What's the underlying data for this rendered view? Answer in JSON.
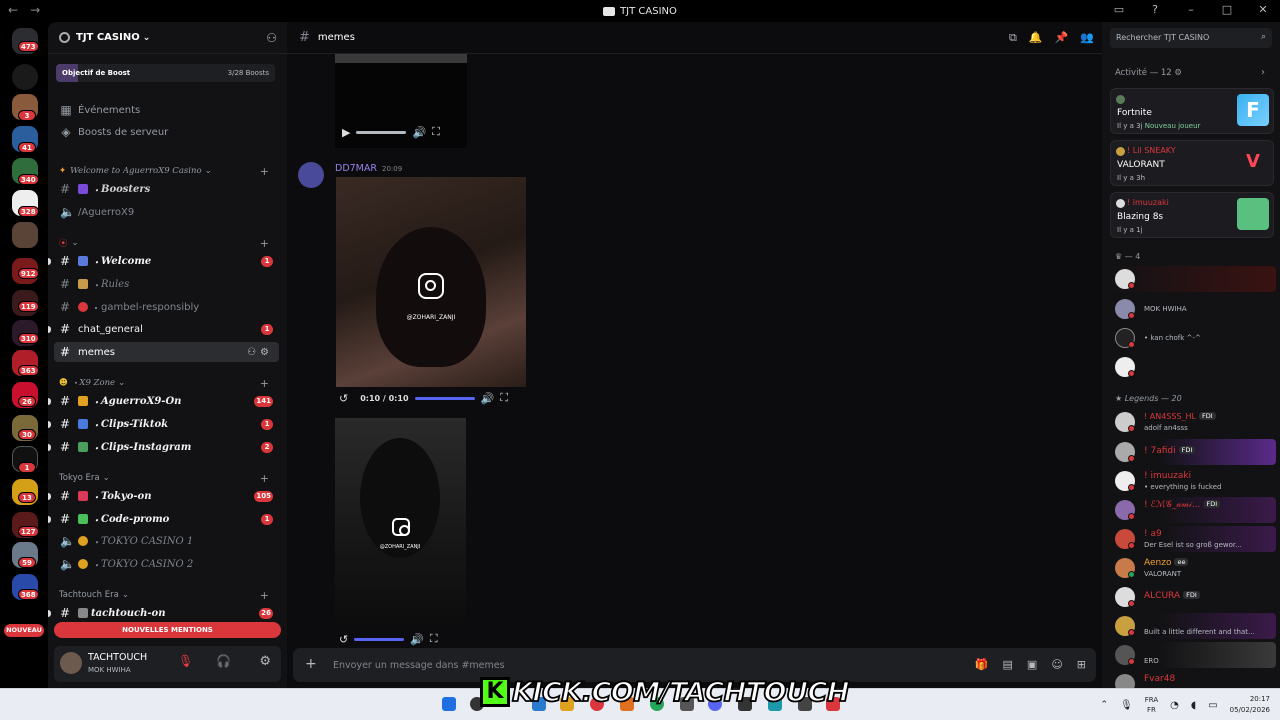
{
  "window": {
    "title": "TJT CASINO",
    "back": "←",
    "forward": "→"
  },
  "rail": {
    "badges": [
      "473",
      "3",
      "41",
      "340",
      "328",
      "912",
      "119",
      "310",
      "363",
      "26",
      "30",
      "1",
      "13",
      "127",
      "59",
      "368"
    ],
    "nouveau": "NOUVEAU"
  },
  "server": {
    "name": "TJT CASINO",
    "boost_label": "Objectif de Boost",
    "boost_count": "3/28 Boosts",
    "events": "Événements",
    "boosts": "Boosts de serveur"
  },
  "categories": {
    "welcome": "Welcome to AguerroX9 Casino",
    "x9zone": "X9 Zone",
    "tokyo": "Tokyo Era",
    "tachtouch": "Tachtouch Era"
  },
  "channels": [
    {
      "name": "Boosters",
      "badge": ""
    },
    {
      "name": "/AguerroX9",
      "badge": ""
    },
    {
      "name": "Welcome",
      "badge": "1"
    },
    {
      "name": "Rules",
      "badge": ""
    },
    {
      "name": "gambel-responsibly",
      "badge": ""
    },
    {
      "name": "chat_general",
      "badge": "1"
    },
    {
      "name": "memes",
      "badge": ""
    },
    {
      "name": "AguerroX9-On",
      "badge": "141"
    },
    {
      "name": "Clips-Tiktok",
      "badge": "1"
    },
    {
      "name": "Clips-Instagram",
      "badge": "2"
    },
    {
      "name": "Tokyo-on",
      "badge": "105"
    },
    {
      "name": "Code-promo",
      "badge": "1"
    },
    {
      "name": "TOKYO CASINO 1",
      "badge": ""
    },
    {
      "name": "TOKYO CASINO 2",
      "badge": ""
    },
    {
      "name": "tachtouch-on",
      "badge": "26"
    }
  ],
  "mentions": "NOUVELLES MENTIONS",
  "user": {
    "name": "TACHTOUCH",
    "status": "MOK HWIHA"
  },
  "channel_header": {
    "name": "memes"
  },
  "message": {
    "author": "DD7MAR",
    "time": "20:09"
  },
  "video": {
    "watermark": "@ZOHARI_ZANJI",
    "time": "0:10 / 0:10",
    "watermark_small": "@ZOHARI_ZANJI"
  },
  "composer": {
    "placeholder": "Envoyer un message dans #memes"
  },
  "search": {
    "placeholder": "Rechercher TJT CASINO"
  },
  "activity": {
    "header": "Activité — 12",
    "cards": [
      {
        "user": "",
        "game": "Fortnite",
        "time": "Il y a 3j",
        "extra": "Nouveau joueur"
      },
      {
        "user": "! Lil SNEAKY",
        "game": "VALORANT",
        "time": "Il y a 3h",
        "extra": ""
      },
      {
        "user": "! imuuzaki",
        "game": "Blazing 8s",
        "time": "Il y a 1j",
        "extra": ""
      }
    ]
  },
  "members": {
    "group1": "— 4",
    "group1_rows": [
      {
        "name": "",
        "status": ""
      },
      {
        "name": "",
        "status": "MOK HWIHA"
      },
      {
        "name": "",
        "status": "• kan chofk ^-^"
      },
      {
        "name": "",
        "status": ""
      }
    ],
    "group2": "Legends — 20",
    "group2_rows": [
      {
        "name": "! AN4SSS_HL",
        "tag": "FDI",
        "status": "adolf an4sss"
      },
      {
        "name": "! 7afidi",
        "tag": "FDI",
        "status": ""
      },
      {
        "name": "! imuuzaki",
        "tag": "",
        "status": "• everything is fucked"
      },
      {
        "name": "! ℰℳ𝒢_𝒶𝓂𝒾...",
        "tag": "FDI",
        "status": ""
      },
      {
        "name": "! a9",
        "tag": "",
        "status": "Der Esel ist so groß gewor..."
      },
      {
        "name": "Aenzo",
        "tag": "ee",
        "status": "VALORANT"
      },
      {
        "name": "ALCURA",
        "tag": "FDI",
        "status": ""
      },
      {
        "name": "",
        "tag": "",
        "status": "Built a little different and that..."
      },
      {
        "name": "",
        "tag": "",
        "status": "ERO"
      },
      {
        "name": "Fvar48",
        "tag": "",
        "status": ""
      }
    ]
  },
  "overlay": {
    "kick": "KICK.COM/TACHTOUCH",
    "k": "K"
  },
  "taskbar": {
    "lang1": "FRA",
    "lang2": "FR",
    "time": "20:17",
    "date": "05/02/2026"
  }
}
